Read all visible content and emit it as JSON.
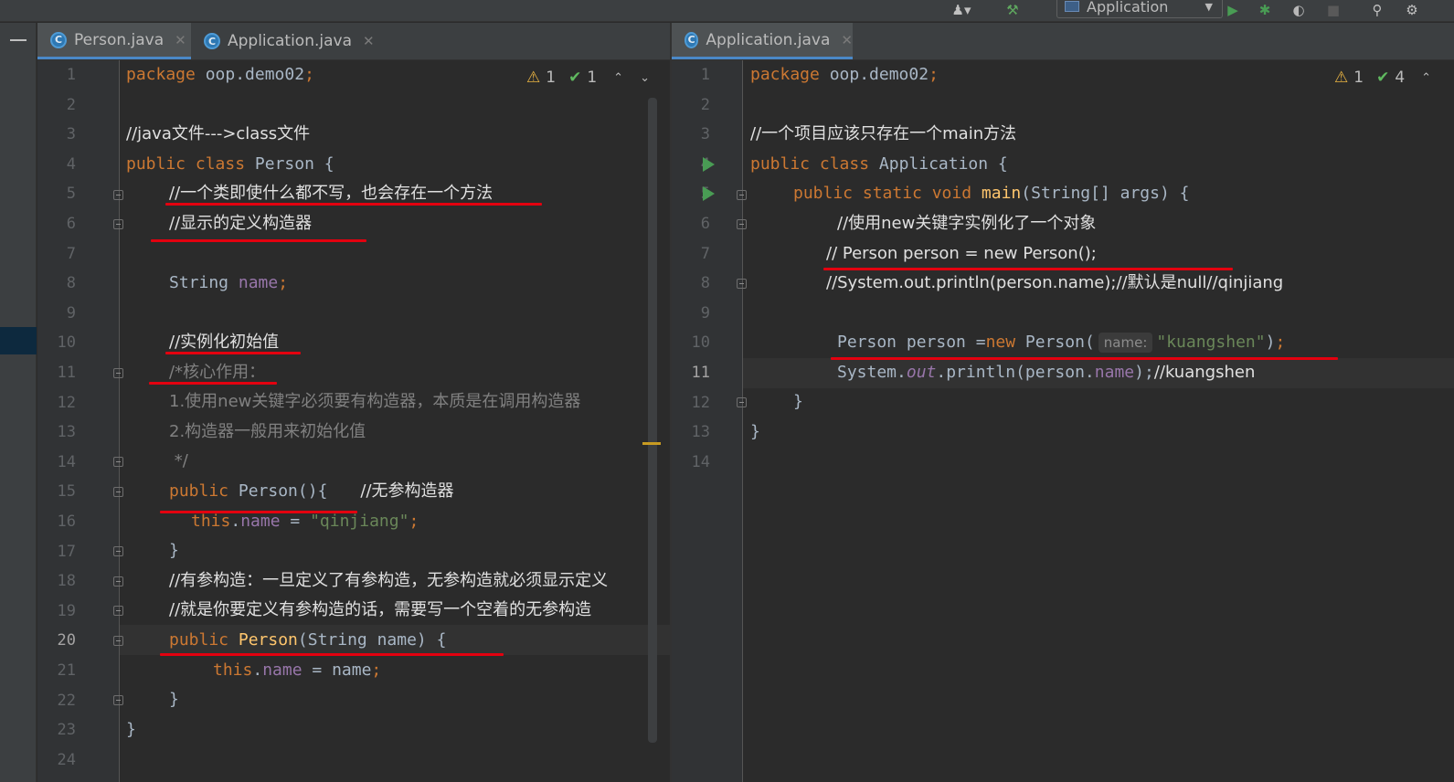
{
  "toolbar": {
    "run_config": "Application"
  },
  "left": {
    "tabs": [
      {
        "label": "Person.java",
        "active": true
      },
      {
        "label": "Application.java",
        "active": false
      }
    ],
    "inspections": {
      "warnings": "1",
      "ok": "1"
    },
    "current_line": 20,
    "lines": [
      {
        "n": "1"
      },
      {
        "n": "2"
      },
      {
        "n": "3"
      },
      {
        "n": "4"
      },
      {
        "n": "5"
      },
      {
        "n": "6"
      },
      {
        "n": "7"
      },
      {
        "n": "8"
      },
      {
        "n": "9"
      },
      {
        "n": "10"
      },
      {
        "n": "11"
      },
      {
        "n": "12"
      },
      {
        "n": "13"
      },
      {
        "n": "14"
      },
      {
        "n": "15"
      },
      {
        "n": "16"
      },
      {
        "n": "17"
      },
      {
        "n": "18"
      },
      {
        "n": "19"
      },
      {
        "n": "20"
      },
      {
        "n": "21"
      },
      {
        "n": "22"
      },
      {
        "n": "23"
      },
      {
        "n": "24"
      }
    ],
    "code": {
      "l1_kw": "package ",
      "l1_rest": "oop.demo02",
      "l1_semi": ";",
      "l3": "//java文件--->class文件",
      "l4_kw": "public class ",
      "l4_rest": "Person {",
      "l5": "//一个类即使什么都不写，也会存在一个方法",
      "l6": "//显示的定义构造器",
      "l8_type": "String ",
      "l8_field": "name",
      "l8_semi": ";",
      "l10": "//实例化初始值",
      "l11": "/*核心作用：",
      "l12": "1.使用new关键字必须要有构造器，本质是在调用构造器",
      "l13": "2.构造器一般用来初始化值",
      "l14": " */",
      "l15_kw": "public ",
      "l15_name": "Person",
      "l15_rest": "(){",
      "l15_cmt": "//无参构造器",
      "l16_kw": "this",
      "l16_dot": ".",
      "l16_field": "name",
      "l16_eq": " = ",
      "l16_str": "\"qinjiang\"",
      "l16_semi": ";",
      "l17": "}",
      "l18": "//有参构造：一旦定义了有参构造，无参构造就必须显示定义",
      "l19": "//就是你要定义有参构造的话，需要写一个空着的无参构造",
      "l20_kw": "public ",
      "l20_name": "Person",
      "l20_rest": "(String name) {",
      "l21_kw": "this",
      "l21_dot": ".",
      "l21_field": "name",
      "l21_rest": " = name",
      "l21_semi": ";",
      "l22": "}",
      "l23": "}"
    }
  },
  "right": {
    "tabs": [
      {
        "label": "Application.java",
        "active": true
      }
    ],
    "inspections": {
      "warnings": "1",
      "ok": "4"
    },
    "current_line": 11,
    "lines": [
      {
        "n": "1"
      },
      {
        "n": "2"
      },
      {
        "n": "3"
      },
      {
        "n": "4"
      },
      {
        "n": "5"
      },
      {
        "n": "6"
      },
      {
        "n": "7"
      },
      {
        "n": "8"
      },
      {
        "n": "9"
      },
      {
        "n": "10"
      },
      {
        "n": "11"
      },
      {
        "n": "12"
      },
      {
        "n": "13"
      },
      {
        "n": "14"
      }
    ],
    "code": {
      "l1_kw": "package ",
      "l1_rest": "oop.demo02",
      "l1_semi": ";",
      "l3": "//一个项目应该只存在一个main方法",
      "l4_kw": "public class ",
      "l4_rest": "Application {",
      "l5_kw": "public static void ",
      "l5_name": "main",
      "l5_rest": "(String[] args) {",
      "l6": "//使用new关键字实例化了一个对象",
      "l7": "// Person person = new Person();",
      "l8": "//System.out.println(person.name);//默认是null//qinjiang",
      "l10_a": "Person person =",
      "l10_kw": "new ",
      "l10_b": "Person(",
      "l10_hint": "name:",
      "l10_str": "\"kuangshen\"",
      "l10_c": ")",
      "l10_semi": ";",
      "l11_a": "System.",
      "l11_out": "out",
      "l11_b": ".println(person.",
      "l11_field": "name",
      "l11_c": ");",
      "l11_cmt": "//kuangshen",
      "l12": "}",
      "l13": "}"
    }
  }
}
